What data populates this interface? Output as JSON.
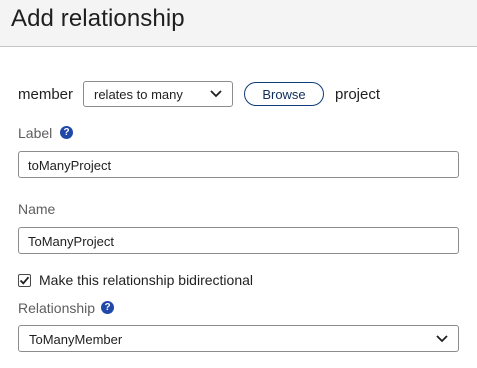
{
  "dialog": {
    "title": "Add relationship"
  },
  "relationship_row": {
    "source_entity": "member",
    "cardinality_value": "relates to many",
    "browse_label": "Browse",
    "target_entity": "project"
  },
  "label_field": {
    "label": "Label",
    "help_icon": "?",
    "value": "toManyProject"
  },
  "name_field": {
    "label": "Name",
    "value": "ToManyProject"
  },
  "bidirectional": {
    "label": "Make this relationship bidirectional",
    "checked": true
  },
  "inverse_field": {
    "label": "Relationship",
    "help_icon": "?",
    "value": "ToManyMember"
  },
  "colors": {
    "accent": "#1f48a8",
    "header_bg": "#f4f4f4",
    "border": "#8c8c8c"
  }
}
